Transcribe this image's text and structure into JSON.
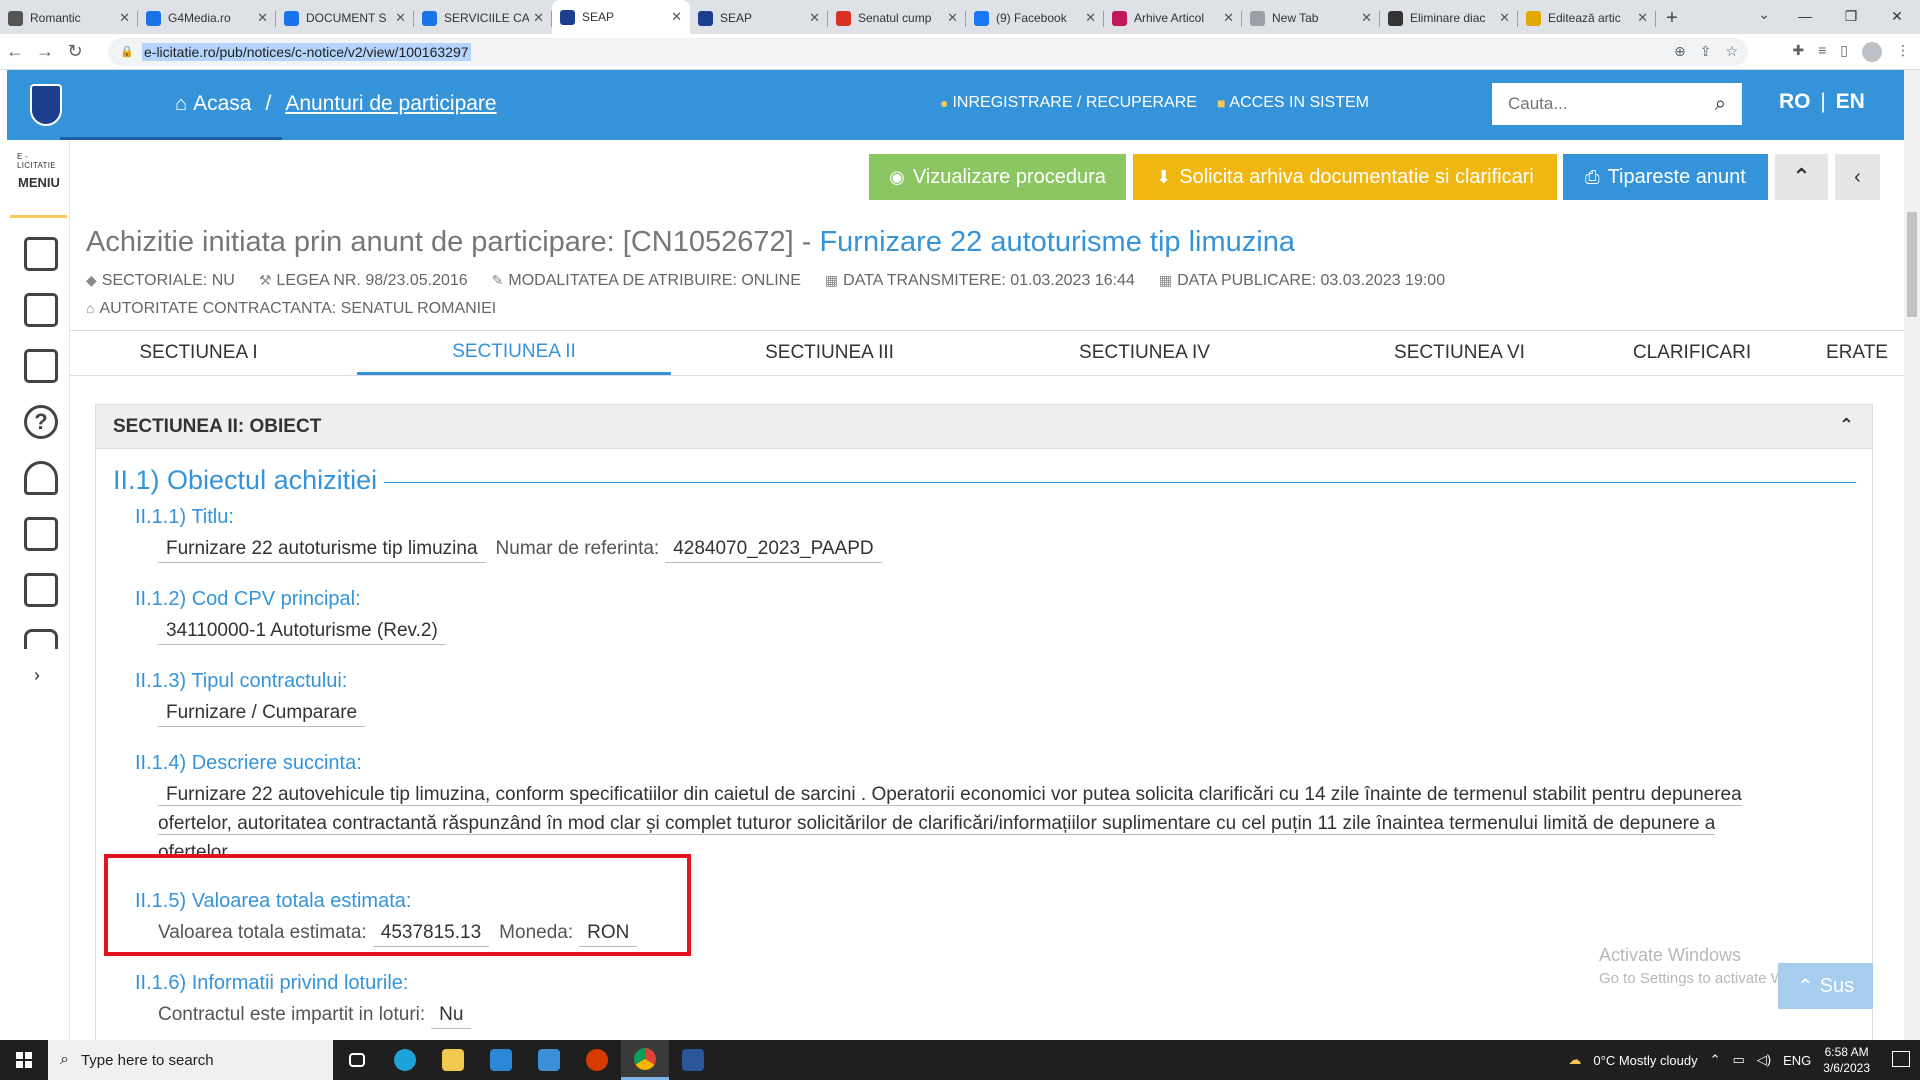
{
  "browser": {
    "tabs": [
      {
        "label": "Romantic",
        "icon": "radio-icon",
        "color": "#555555"
      },
      {
        "label": "G4Media.ro",
        "icon": "g4-icon",
        "color": "#1a73e8"
      },
      {
        "label": "DOCUMENT S",
        "icon": "g4-icon",
        "color": "#1a73e8"
      },
      {
        "label": "SERVICIILE CA",
        "icon": "g4-icon",
        "color": "#1a73e8"
      },
      {
        "label": "SEAP",
        "icon": "seap-icon",
        "color": "#1b3f8c"
      },
      {
        "label": "SEAP",
        "icon": "seap-icon",
        "color": "#1b3f8c"
      },
      {
        "label": "Senatul cump",
        "icon": "gmail-icon",
        "color": "#d93025"
      },
      {
        "label": "(9) Facebook",
        "icon": "facebook-icon",
        "color": "#1877f2"
      },
      {
        "label": "Arhive Articol",
        "icon": "arhive-icon",
        "color": "#c2185b"
      },
      {
        "label": "New Tab",
        "icon": "newtab-icon",
        "color": "#9aa0a6"
      },
      {
        "label": "Eliminare diac",
        "icon": "ab-icon",
        "color": "#333333"
      },
      {
        "label": "Editează artic",
        "icon": "wp-icon",
        "color": "#e0a800"
      }
    ],
    "url": "e-licitatie.ro/pub/notices/c-notice/v2/view/100163297"
  },
  "header": {
    "home_label": "Acasa",
    "breadcrumb_current": "Anunturi de participare",
    "register_label": "INREGISTRARE / RECUPERARE",
    "login_label": "ACCES IN SISTEM",
    "search_placeholder": "Cauta...",
    "lang_ro": "RO",
    "lang_sep": "|",
    "lang_en": "EN"
  },
  "sidebar": {
    "brand": "E - LICITATIE",
    "menu_label": "MENIU",
    "icons": [
      "notice-icon",
      "list-icon",
      "checklist-icon",
      "help-icon",
      "tree-icon",
      "id-card-icon",
      "folder-icon",
      "chat-icon"
    ]
  },
  "actions": {
    "view_procedure": "Vizualizare procedura",
    "request_archive": "Solicita arhiva documentatie si clarificari",
    "print_notice": "Tipareste anunt"
  },
  "procedure": {
    "title_prefix": "Achizitie initiata prin anunt de participare: [CN1052672] - ",
    "title_highlight": "Furnizare 22 autoturisme tip limuzina",
    "sectoriale": "SECTORIALE: NU",
    "lege": "LEGEA NR. 98/23.05.2016",
    "modalitate": "MODALITATEA DE ATRIBUIRE: ONLINE",
    "transmitere": "DATA TRANSMITERE: 01.03.2023 16:44",
    "publicare": "DATA PUBLICARE: 03.03.2023 19:00",
    "autoritate": "AUTORITATE CONTRACTANTA: SENATUL ROMANIEI"
  },
  "section_tabs": [
    "SECTIUNEA I",
    "SECTIUNEA II",
    "SECTIUNEA III",
    "SECTIUNEA IV",
    "SECTIUNEA VI",
    "CLARIFICARI",
    "ERATE"
  ],
  "panel": {
    "title": "SECTIUNEA II: OBIECT",
    "heading": "II.1) Obiectul achizitiei",
    "titlu_label": "II.1.1) Titlu:",
    "titlu_value": "Furnizare 22 autoturisme tip limuzina",
    "ref_label": "Numar de referinta:",
    "ref_value": "4284070_2023_PAAPD",
    "cpv_label": "II.1.2) Cod CPV principal:",
    "cpv_value": "34110000-1 Autoturisme (Rev.2)",
    "tip_label": "II.1.3) Tipul contractului:",
    "tip_value": "Furnizare / Cumparare",
    "desc_label": "II.1.4) Descriere succinta:",
    "desc_value": "Furnizare 22 autovehicule tip limuzina, conform specificatiilor din caietul de sarcini . Operatorii economici vor putea solicita clarificări cu 14 zile înainte de termenul stabilit pentru depunerea ofertelor, autoritatea contractantă răspunzând în mod clar și complet tuturor solicitărilor de clarificări/informațiilor suplimentare cu cel puțin 11 zile înaintea termenului limită de depunere a ofertelor.",
    "val_label": "II.1.5) Valoarea totala estimata:",
    "val_field_label": "Valoarea totala estimata:",
    "val_value": "4537815.13",
    "moneda_label": "Moneda:",
    "moneda_value": "RON",
    "loturi_label": "II.1.6) Informatii privind loturile:",
    "loturi_field_label": "Contractul este impartit in loturi:",
    "loturi_value": "Nu"
  },
  "watermark": {
    "line1": "Activate Windows",
    "line2": "Go to Settings to activate Windows."
  },
  "scroll_top_label": "Sus",
  "taskbar": {
    "search_placeholder": "Type here to search",
    "weather": "0°C  Mostly cloudy",
    "lang": "ENG",
    "time": "6:58 AM",
    "date": "3/6/2023"
  }
}
